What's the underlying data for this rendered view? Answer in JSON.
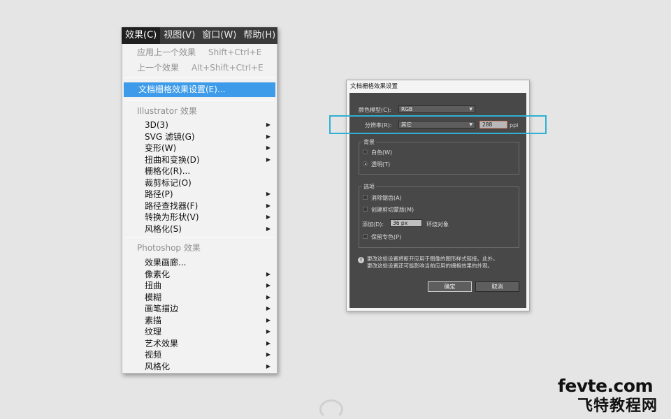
{
  "menubar": [
    "效果(C)",
    "视图(V)",
    "窗口(W)",
    "帮助(H)"
  ],
  "menu": {
    "apply_last": {
      "label": "应用上一个效果",
      "shortcut": "Shift+Ctrl+E"
    },
    "last": {
      "label": "上一个效果",
      "shortcut": "Alt+Shift+Ctrl+E"
    },
    "raster_settings": "文档栅格效果设置(E)...",
    "illustrator_header": "Illustrator 效果",
    "illustrator_items": [
      {
        "label": "3D(3)",
        "submenu": true
      },
      {
        "label": "SVG 滤镜(G)",
        "submenu": true
      },
      {
        "label": "变形(W)",
        "submenu": true
      },
      {
        "label": "扭曲和变换(D)",
        "submenu": true
      },
      {
        "label": "栅格化(R)...",
        "submenu": false
      },
      {
        "label": "裁剪标记(O)",
        "submenu": false
      },
      {
        "label": "路径(P)",
        "submenu": true
      },
      {
        "label": "路径查找器(F)",
        "submenu": true
      },
      {
        "label": "转换为形状(V)",
        "submenu": true
      },
      {
        "label": "风格化(S)",
        "submenu": true
      }
    ],
    "photoshop_header": "Photoshop 效果",
    "photoshop_items": [
      {
        "label": "效果画廊...",
        "submenu": false
      },
      {
        "label": "像素化",
        "submenu": true
      },
      {
        "label": "扭曲",
        "submenu": true
      },
      {
        "label": "模糊",
        "submenu": true
      },
      {
        "label": "画笔描边",
        "submenu": true
      },
      {
        "label": "素描",
        "submenu": true
      },
      {
        "label": "纹理",
        "submenu": true
      },
      {
        "label": "艺术效果",
        "submenu": true
      },
      {
        "label": "视频",
        "submenu": true
      },
      {
        "label": "风格化",
        "submenu": true
      }
    ]
  },
  "dialog": {
    "title": "文档栅格效果设置",
    "color_model_label": "颜色模型(C):",
    "color_model_value": "RGB",
    "resolution_label": "分辨率(R):",
    "resolution_value": "其它",
    "resolution_input": "288",
    "resolution_unit": "ppi",
    "background_title": "背景",
    "bg_white": "白色(W)",
    "bg_transparent": "透明(T)",
    "options_title": "选项",
    "opt_antialias": "消除锯齿(A)",
    "opt_clipping_mask": "创建剪切蒙版(M)",
    "add_label": "添加(D):",
    "add_value": "36 px",
    "add_suffix": "环绕对象",
    "opt_preserve_spot": "保留专色(P)",
    "info_line1": "更改这些设置将断开应用于图像的图形样式链接。此外，",
    "info_line2": "更改这些设置还可能影响当前应用的栅格效果的外观。",
    "ok": "确定",
    "cancel": "取消"
  },
  "watermark": {
    "url": "fevte.com",
    "cn": "飞特教程网"
  }
}
